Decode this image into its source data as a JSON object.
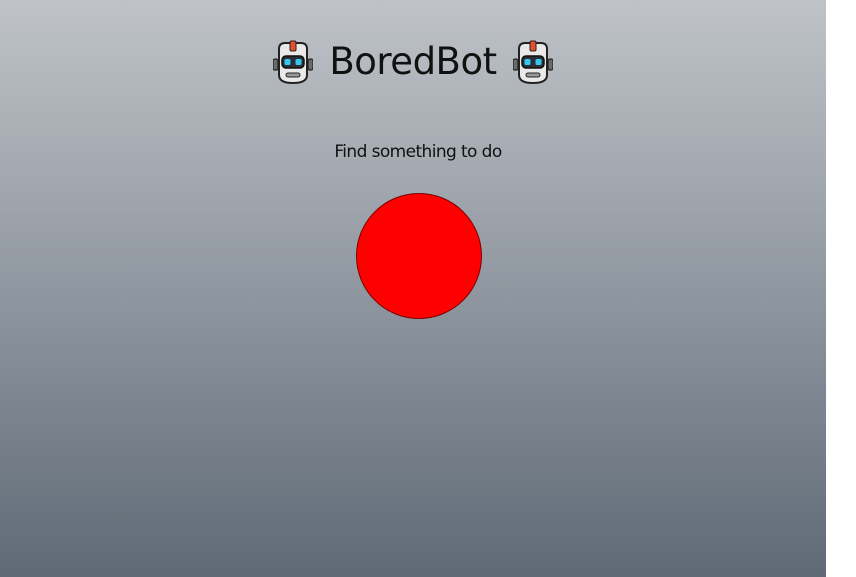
{
  "app": {
    "title": "BoredBot",
    "subtitle": "Find something to do"
  },
  "icons": {
    "left": "robot-icon",
    "right": "robot-icon"
  },
  "colors": {
    "button": "#ff0000",
    "background_top": "#bfc3c8",
    "background_bottom": "#5f6a76"
  }
}
